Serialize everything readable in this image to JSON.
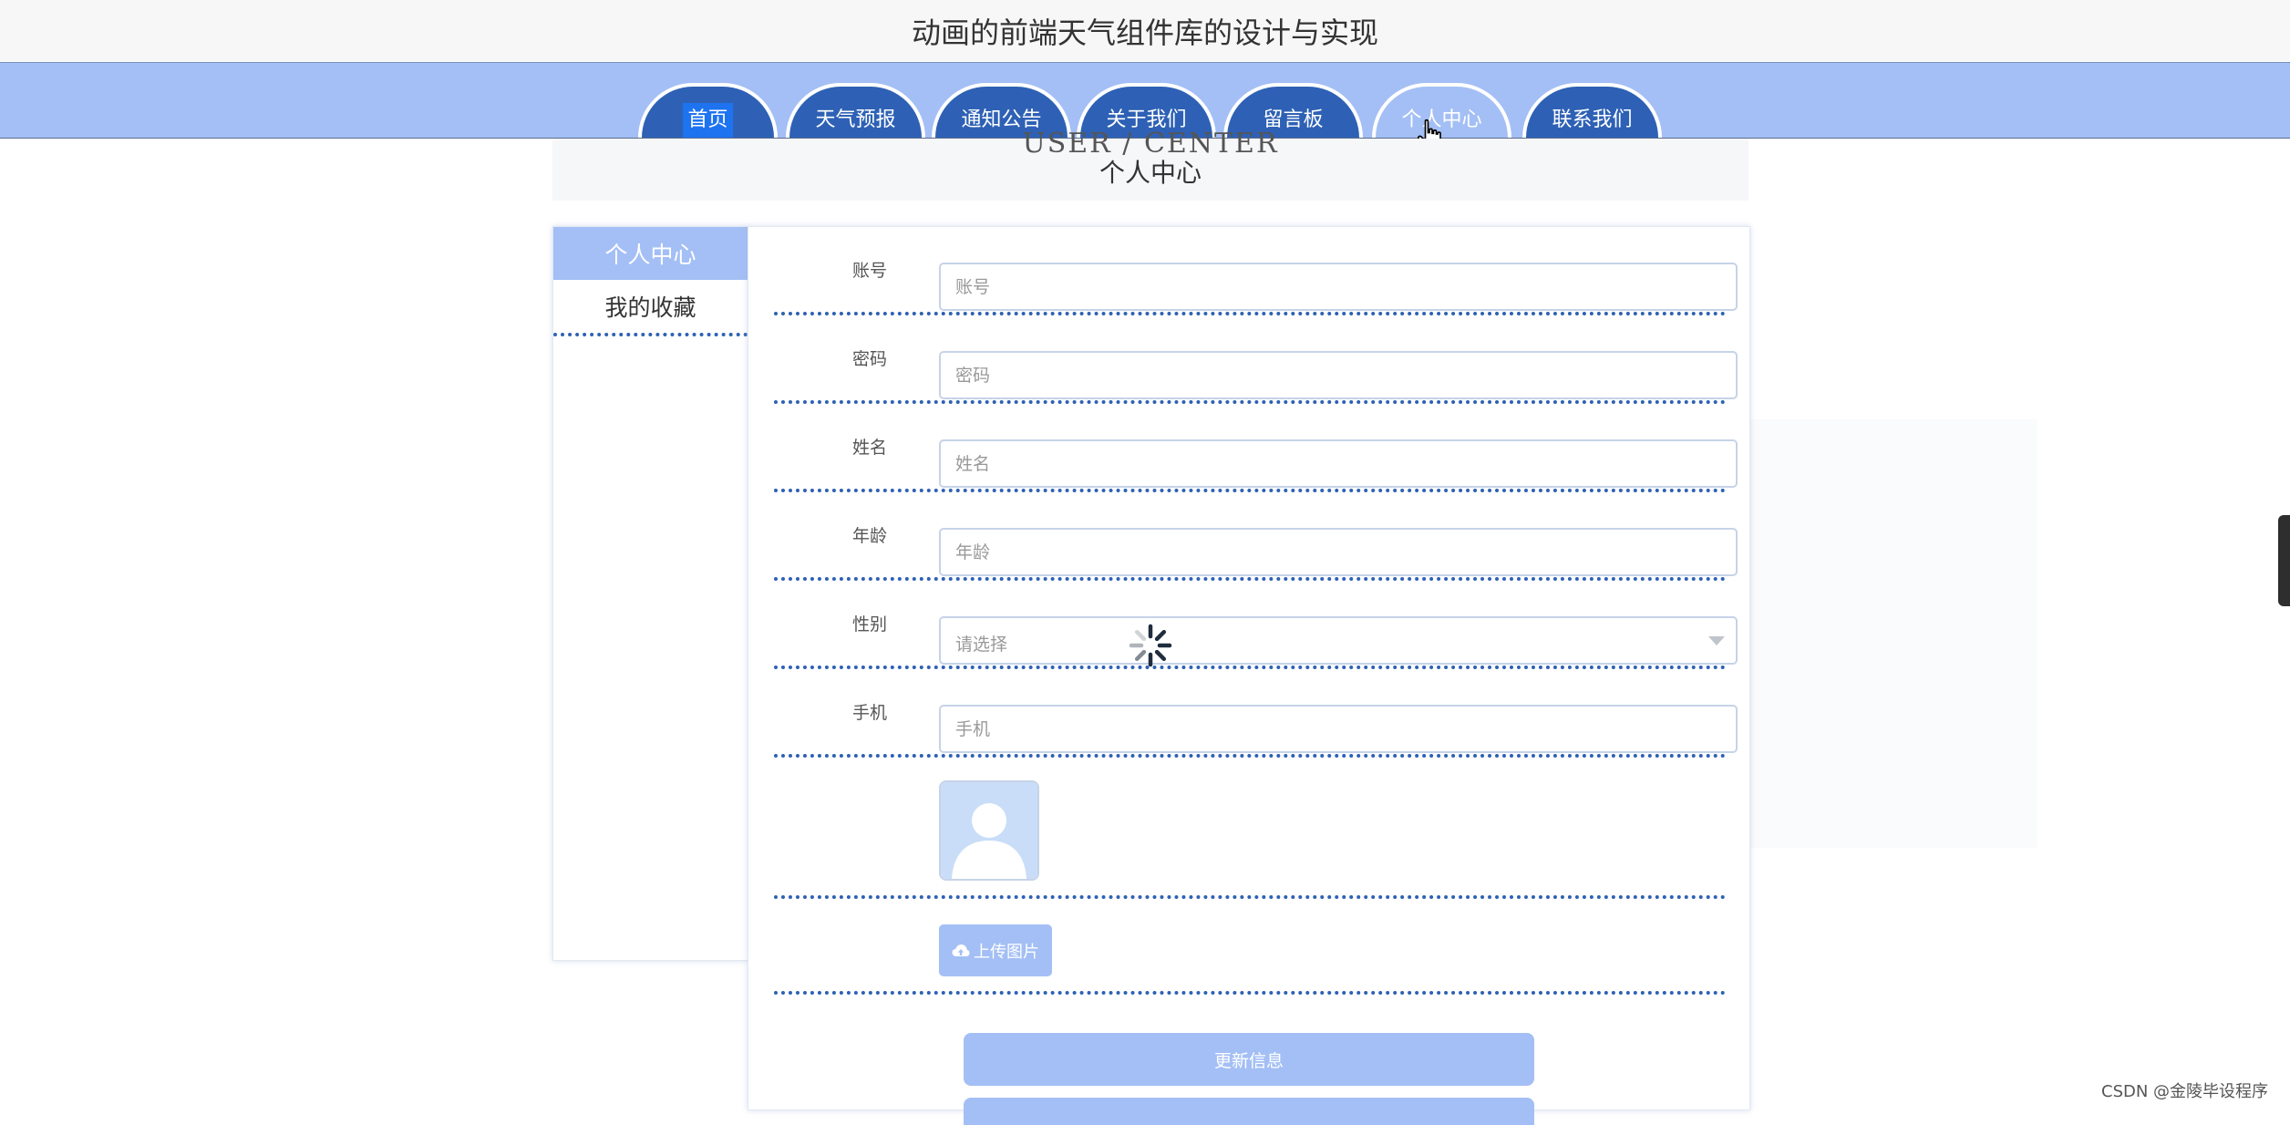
{
  "app_title": "动画的前端天气组件库的设计与实现",
  "nav": {
    "tabs": [
      {
        "label": "首页"
      },
      {
        "label": "天气预报"
      },
      {
        "label": "通知公告"
      },
      {
        "label": "关于我们"
      },
      {
        "label": "留言板"
      },
      {
        "label": "个人中心"
      },
      {
        "label": "联系我们"
      }
    ],
    "active_tab": "个人中心"
  },
  "banner": {
    "subtitle_en": "USER / CENTER",
    "title_cn": "个人中心"
  },
  "sidebar": {
    "items": [
      {
        "label": "个人中心"
      },
      {
        "label": "我的收藏"
      }
    ],
    "active": "个人中心"
  },
  "form": {
    "account": {
      "label": "账号",
      "placeholder": "账号"
    },
    "password": {
      "label": "密码",
      "placeholder": "密码"
    },
    "name": {
      "label": "姓名",
      "placeholder": "姓名"
    },
    "age": {
      "label": "年龄",
      "placeholder": "年龄"
    },
    "gender": {
      "label": "性别",
      "placeholder": "请选择"
    },
    "phone": {
      "label": "手机",
      "placeholder": "手机"
    },
    "upload_label": "上传图片",
    "update_label": "更新信息"
  },
  "watermark": "CSDN @金陵毕设程序",
  "colors": {
    "nav_bg": "#a4bff5",
    "tab_bg": "#2e61b5",
    "accent": "#a4bff5",
    "dotted": "#2e61b5"
  }
}
